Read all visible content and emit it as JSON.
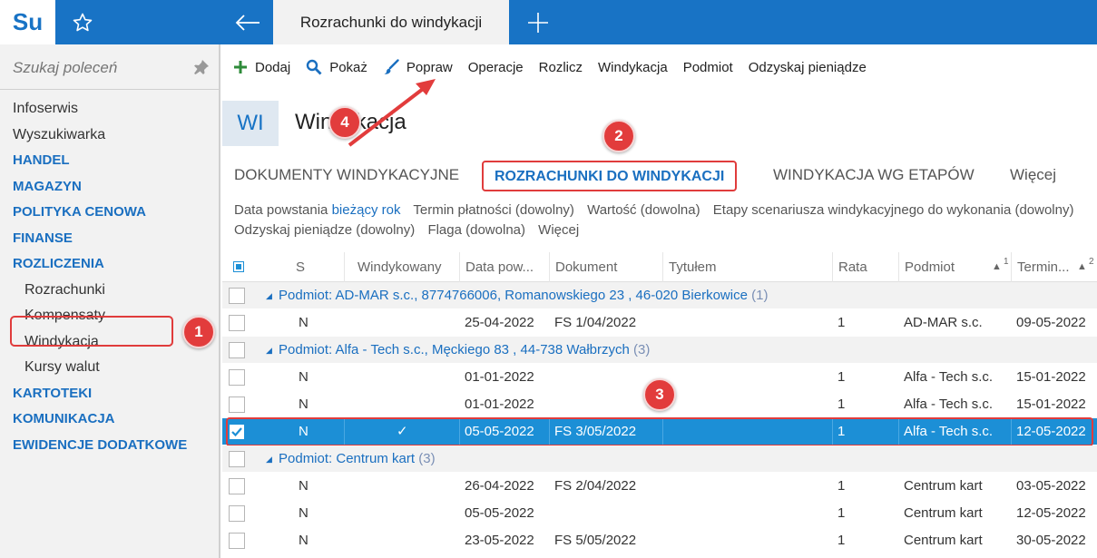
{
  "app": {
    "logo": "Su",
    "tab_title": "Rozrachunki do windykacji"
  },
  "sidebar": {
    "search_placeholder": "Szukaj poleceń",
    "items": [
      {
        "label": "Infoserwis",
        "kind": "item"
      },
      {
        "label": "Wyszukiwarka",
        "kind": "item"
      },
      {
        "label": "HANDEL",
        "kind": "section"
      },
      {
        "label": "MAGAZYN",
        "kind": "section"
      },
      {
        "label": "POLITYKA CENOWA",
        "kind": "section"
      },
      {
        "label": "FINANSE",
        "kind": "section"
      },
      {
        "label": "ROZLICZENIA",
        "kind": "section"
      },
      {
        "label": "Rozrachunki",
        "kind": "sub"
      },
      {
        "label": "Kompensaty",
        "kind": "sub"
      },
      {
        "label": "Windykacja",
        "kind": "sub"
      },
      {
        "label": "Kursy walut",
        "kind": "sub"
      },
      {
        "label": "KARTOTEKI",
        "kind": "section"
      },
      {
        "label": "KOMUNIKACJA",
        "kind": "section"
      },
      {
        "label": "EWIDENCJE DODATKOWE",
        "kind": "section"
      }
    ]
  },
  "toolbar": {
    "dodaj": "Dodaj",
    "pokaz": "Pokaż",
    "popraw": "Popraw",
    "operacje": "Operacje",
    "rozlicz": "Rozlicz",
    "windykacja": "Windykacja",
    "podmiot": "Podmiot",
    "odzyskaj": "Odzyskaj pieniądze"
  },
  "page": {
    "badge": "WI",
    "title": "Windykacja"
  },
  "subtabs": {
    "dokumenty": "DOKUMENTY WINDYKACYJNE",
    "rozrachunki": "ROZRACHUNKI DO WINDYKACJI",
    "etapy": "WINDYKACJA WG ETAPÓW",
    "wiecej": "Więcej"
  },
  "filters": {
    "data_label": "Data powstania",
    "data_value": "bieżący rok",
    "termin": "Termin płatności (dowolny)",
    "wartosc": "Wartość (dowolna)",
    "etapy": "Etapy scenariusza windykacyjnego do wykonania (dowolny)",
    "odzyskaj": "Odzyskaj pieniądze (dowolny)",
    "flaga": "Flaga (dowolna)",
    "wiecej": "Więcej"
  },
  "grid": {
    "headers": {
      "s": "S",
      "windykowany": "Windykowany",
      "data": "Data pow...",
      "dokument": "Dokument",
      "tytulem": "Tytułem",
      "rata": "Rata",
      "podmiot": "Podmiot",
      "podmiot_sort": "1",
      "termin": "Termin...",
      "termin_sort": "2"
    },
    "rows": [
      {
        "type": "group",
        "label": "Podmiot: AD-MAR s.c., 8774766006, Romanowskiego 23 , 46-020 Bierkowice",
        "count": "(1)"
      },
      {
        "type": "data",
        "s": "N",
        "wind": "",
        "data": "25-04-2022",
        "dok": "FS 1/04/2022",
        "rata": "1",
        "podmiot": "AD-MAR s.c.",
        "termin": "09-05-2022"
      },
      {
        "type": "group",
        "label": "Podmiot: Alfa - Tech s.c., Męckiego  83 , 44-738 Wałbrzych",
        "count": "(3)"
      },
      {
        "type": "data",
        "s": "N",
        "wind": "",
        "data": "01-01-2022",
        "dok": "",
        "rata": "1",
        "podmiot": "Alfa - Tech s.c.",
        "termin": "15-01-2022"
      },
      {
        "type": "data",
        "s": "N",
        "wind": "",
        "data": "01-01-2022",
        "dok": "",
        "rata": "1",
        "podmiot": "Alfa - Tech s.c.",
        "termin": "15-01-2022"
      },
      {
        "type": "data",
        "s": "N",
        "wind": "✓",
        "data": "05-05-2022",
        "dok": "FS 3/05/2022",
        "rata": "1",
        "podmiot": "Alfa - Tech s.c.",
        "termin": "12-05-2022",
        "selected": true
      },
      {
        "type": "group",
        "label": "Podmiot: Centrum kart",
        "count": "(3)"
      },
      {
        "type": "data",
        "s": "N",
        "wind": "",
        "data": "26-04-2022",
        "dok": "FS 2/04/2022",
        "rata": "1",
        "podmiot": "Centrum kart",
        "termin": "03-05-2022"
      },
      {
        "type": "data",
        "s": "N",
        "wind": "",
        "data": "05-05-2022",
        "dok": "",
        "rata": "1",
        "podmiot": "Centrum kart",
        "termin": "12-05-2022"
      },
      {
        "type": "data",
        "s": "N",
        "wind": "",
        "data": "23-05-2022",
        "dok": "FS 5/05/2022",
        "rata": "1",
        "podmiot": "Centrum kart",
        "termin": "30-05-2022"
      }
    ]
  },
  "callouts": {
    "one": "1",
    "two": "2",
    "three": "3",
    "four": "4"
  }
}
